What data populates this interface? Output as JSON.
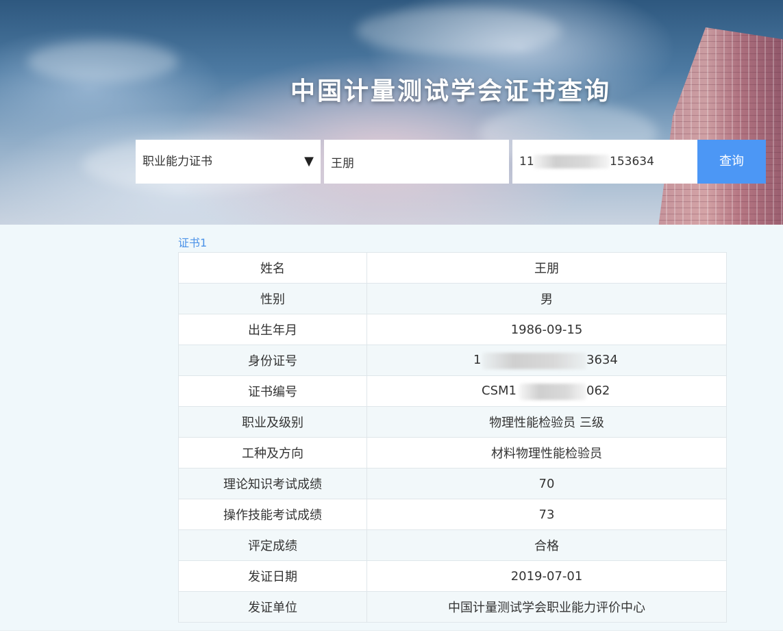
{
  "header": {
    "title": "中国计量测试学会证书查询"
  },
  "search": {
    "cert_type": "职业能力证书",
    "name_value": "王朋",
    "id_prefix": "11",
    "id_suffix": "153634",
    "query_label": "查询"
  },
  "result": {
    "tab_label": "证书1",
    "rows": [
      {
        "key": "姓名",
        "value": "王朋"
      },
      {
        "key": "性别",
        "value": "男"
      },
      {
        "key": "出生年月",
        "value": "1986-09-15"
      },
      {
        "key": "身份证号",
        "value": "1",
        "value_suffix": "3634"
      },
      {
        "key": "证书编号",
        "value": "CSM1",
        "value_suffix": "062"
      },
      {
        "key": "职业及级别",
        "value": "物理性能检验员 三级"
      },
      {
        "key": "工种及方向",
        "value": "材料物理性能检验员"
      },
      {
        "key": "理论知识考试成绩",
        "value": "70"
      },
      {
        "key": "操作技能考试成绩",
        "value": "73"
      },
      {
        "key": "评定成绩",
        "value": "合格"
      },
      {
        "key": "发证日期",
        "value": "2019-07-01"
      },
      {
        "key": "发证单位",
        "value": "中国计量测试学会职业能力评价中心"
      }
    ]
  },
  "colors": {
    "accent": "#4c97f5",
    "tab_text": "#4b92e8",
    "content_bg": "#f0f8fb"
  }
}
